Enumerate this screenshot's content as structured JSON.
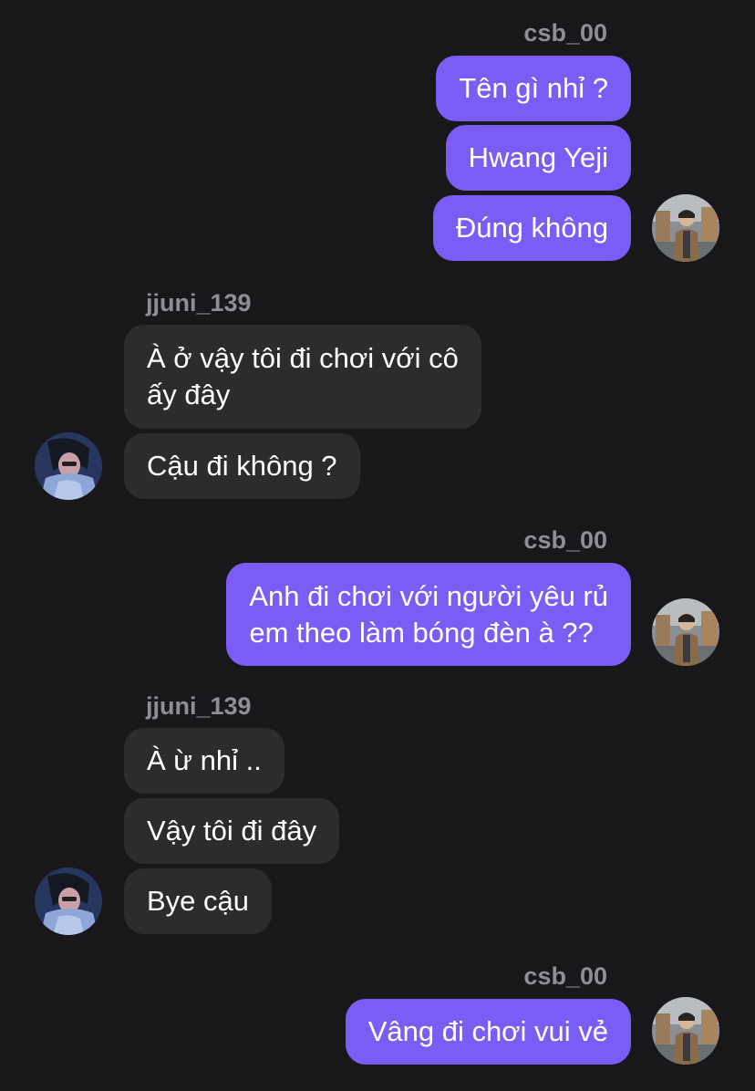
{
  "conversation": {
    "me": "csb_00",
    "other": "jjuni_139",
    "blocks": [
      {
        "sender": "csb_00",
        "messages": [
          "Tên gì nhỉ ?",
          "Hwang Yeji",
          "Đúng không"
        ]
      },
      {
        "sender": "jjuni_139",
        "messages": [
          "À ở vậy tôi đi chơi với cô\nấy đây",
          "Cậu đi không ?"
        ]
      },
      {
        "sender": "csb_00",
        "messages": [
          "Anh đi chơi với người yêu rủ\nem theo làm bóng đèn à ??"
        ]
      },
      {
        "sender": "jjuni_139",
        "messages": [
          "À ừ nhỉ ..",
          "Vậy tôi đi đây",
          "Bye cậu"
        ]
      },
      {
        "sender": "csb_00",
        "messages": [
          "Vâng đi chơi vui vẻ"
        ]
      }
    ]
  },
  "colors": {
    "background": "#18181b",
    "outgoing_bubble": "#7b5cf5",
    "incoming_bubble": "#2c2c2e",
    "username": "#8e8e93",
    "text": "#ffffff"
  },
  "icons": {
    "me_avatar": "avatar-photo-man-in-coat",
    "other_avatar": "avatar-photo-person-blue"
  }
}
